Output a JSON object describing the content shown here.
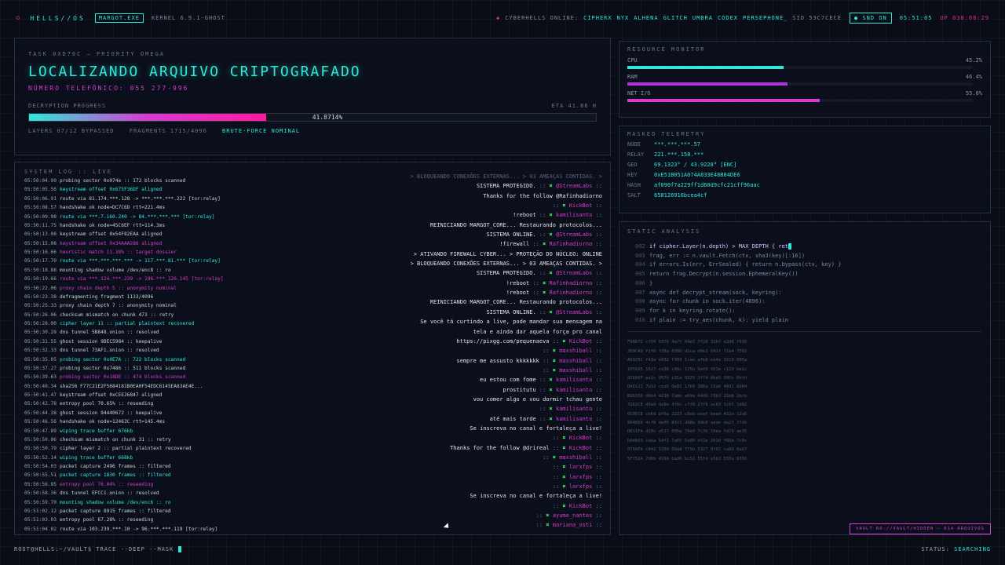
{
  "topbar": {
    "logo": "◇",
    "brand": "HELLS//OS",
    "user_tag": "MARGOT.EXE",
    "kernel": "KERNEL 6.9.1-GHOST",
    "online_label": "CYBERHELLS ONLINE:",
    "online_users": [
      "CIPHERX",
      "NYX",
      "ALHENA",
      "GLITCH",
      "UMBRA",
      "CODEX",
      "PERSEPHONE_"
    ],
    "sid": "SID 53C7CECE",
    "snd": "SND ON",
    "clock": "05:51:05",
    "uptime": "UP 038:08:29"
  },
  "task": {
    "id": "TASK 0XD70C — PRIORITY OMEGA",
    "title": "LOCALIZANDO ARQUIVO CRIPTOGRAFADO",
    "phone": "NÚMERO TELEFÔNICO: 055 277-996",
    "progress_label": "DECRYPTION PROGRESS",
    "eta": "ETA 41.86 H",
    "progress": 41.8714,
    "progress_text": "41.8714%",
    "layers": "LAYERS 07/12 BYPASSED",
    "fragments": "FRAGMENTS 1715/4096",
    "bruteforce": "BRUTE-FORCE NOMINAL"
  },
  "resource": {
    "title": "RESOURCE MONITOR",
    "items": [
      {
        "label": "CPU",
        "value": "45.2%",
        "pct": 45.2,
        "color": "#2ee8d8"
      },
      {
        "label": "RAM",
        "value": "46.4%",
        "pct": 46.4,
        "color": "#b530e0"
      },
      {
        "label": "NET I/O",
        "value": "55.6%",
        "pct": 55.6,
        "color": "#d73bd0"
      }
    ]
  },
  "telemetry": {
    "title": "MASKED TELEMETRY",
    "rows": [
      {
        "k": "NODE",
        "v": "***.***.***.57"
      },
      {
        "k": "RELAY",
        "v": "221.***.158.***"
      },
      {
        "k": "GEO",
        "v": "69.1323° / 43.9228° [ENC]"
      },
      {
        "k": "KEY",
        "v": "0xE51B051A074A833E48B84DE6"
      },
      {
        "k": "HASH",
        "v": "af090f7a229ff1d60d9cfc21cff96aac"
      },
      {
        "k": "SALT",
        "v": "658126916bcea4cf"
      }
    ]
  },
  "static": {
    "title": "STATIC ANALYSIS",
    "lines": [
      {
        "n": "002",
        "t": "if cipher.Layer(n.depth) > MAX_DEPTH { ret",
        "hi": true
      },
      {
        "n": "003",
        "t": "frag, err := n.vault.Fetch(ctx, sha3(key)[:16])"
      },
      {
        "n": "004",
        "t": "if errors.Is(err, ErrSealed) { return n.bypass(ctx, key) }"
      },
      {
        "n": "005",
        "t": "return frag.Decrypt(n.session.EphemeralKey())"
      },
      {
        "n": "006",
        "t": "}"
      },
      {
        "n": "007",
        "t": "async def decrypt_stream(sock, keyring):"
      },
      {
        "n": "008",
        "t": "async for chunk in sock.iter(4096):"
      },
      {
        "n": "009",
        "t": "for k in keyring.rotate():"
      },
      {
        "n": "010",
        "t": "if plain := try_aes(chunk, k): yield plain"
      }
    ],
    "hex": [
      "F9BD72 cf50 037b 4a7f 04e3 ff28 31bf a3d6 f035",
      "2E0CA9 f2f6 f28a 6380 d2ca d0e1 641f 71b4 7592",
      "A6025C f43a e932 f309 1cae afb8 ea4a 3219 605a",
      "105165 1627 ca38 c08c 125b 9af0 953e c123 be1c",
      "83606F ea1c 957b c31a 0325 1f7d 8be5 305c 0bfd",
      "DA0122 7b12 cea5 0e02 17b9 388a 15a6 4601 8d04",
      "B9535D d6b4 4238 7a8e a69a 44d9 73b3 21b8 2bcb",
      "72E2CE d0a9 da9e 4f6c c7f8 2ff6 ac63 5c65 1d82",
      "0C8ECE cb6d bf6a 2223 c8eb eeaf bead 422a 12a6",
      "804EE0 4cf8 de05 83f2 d98b 99b0 adde de27 77d5",
      "D011FA d20c a517 005e 79e0 7c3b 10ea fd79 ae35",
      "D04663 cbea 54f1 7a6f 5a00 df2e 2010 f66b 7c0c",
      "570AFA c842 5260 09a8 7f5b 5327 0f02 ca8d 8a67",
      "5F7524 7d0b 4166 ba36 bc52 55fd e5b3 555a 635b"
    ]
  },
  "vault": "VAULT RO://VAULT/HIDDEN — 814 ARQUIVOS",
  "syslog": {
    "title": "SYSTEM LOG :: LIVE",
    "entries": [
      {
        "t": "05:50:04.99",
        "m": "probing sector 0x074e :: 172 blocks scanned",
        "c": ""
      },
      {
        "t": "05:50:05.56",
        "m": "keystream offset 0x675F36DF aligned",
        "c": "c"
      },
      {
        "t": "05:50:06.91",
        "m": "route via 81.174.***.128 -> ***.***.***.222 [tor:relay]",
        "c": ""
      },
      {
        "t": "05:50:08.57",
        "m": "handshake ok node=DC7C6D rtt=221.4ms",
        "c": ""
      },
      {
        "t": "05:50:09.98",
        "m": "route via ***.7.160.240 -> 84.***.***.*** [tor:relay]",
        "c": "c"
      },
      {
        "t": "05:50:11.75",
        "m": "handshake ok node=45C6EF rtt=114.3ms",
        "c": ""
      },
      {
        "t": "05:50:13.08",
        "m": "keystream offset 0x54F82EAA aligned",
        "c": ""
      },
      {
        "t": "05:50:15.08",
        "m": "keystream offset 0x34AAA286 aligned",
        "c": "m"
      },
      {
        "t": "05:50:16.66",
        "m": "heuristic match 11.38% :: target dossier",
        "c": "m"
      },
      {
        "t": "05:50:17.70",
        "m": "route via ***.***.***.*** -> 117.***.81.*** [tor:relay]",
        "c": "c"
      },
      {
        "t": "05:50:18.88",
        "m": "mounting shadow volume /dev/enc8 :: ro",
        "c": ""
      },
      {
        "t": "05:50:19.66",
        "m": "route via ***.124.***.239 -> 196.***.126.145 [tor:relay]",
        "c": "m"
      },
      {
        "t": "05:50:22.06",
        "m": "proxy chain depth 5 :: anonymity nominal",
        "c": "m"
      },
      {
        "t": "05:50:23.38",
        "m": "defragmenting fragment 1133/4096",
        "c": ""
      },
      {
        "t": "05:50:25.33",
        "m": "proxy chain depth 7 :: anonymity nominal",
        "c": ""
      },
      {
        "t": "05:50:26.06",
        "m": "checksum mismatch on chunk 473 :: retry",
        "c": ""
      },
      {
        "t": "05:50:28.00",
        "m": "cipher layer 11 :: partial plaintext recovered",
        "c": "c"
      },
      {
        "t": "05:50:30.28",
        "m": "dns tunnel 5B848.onion :: resolved",
        "c": ""
      },
      {
        "t": "05:50:31.55",
        "m": "ghost session 9DEC5984 :: keepalive",
        "c": ""
      },
      {
        "t": "05:50:32.33",
        "m": "dns tunnel 73AF1.onion :: resolved",
        "c": ""
      },
      {
        "t": "05:50:35.05",
        "m": "probing sector 0x0E7A :: 722 blocks scanned",
        "c": "c"
      },
      {
        "t": "05:50:37.27",
        "m": "probing sector 0x7486 :: 511 blocks scanned",
        "c": ""
      },
      {
        "t": "05:50:39.63",
        "m": "probing sector 0x18DE :: 474 blocks scanned",
        "c": "m"
      },
      {
        "t": "05:50:40.34",
        "m": "sha256 F77C21E2F5684181B0EA0F54EDC614SEA83AE4E...",
        "c": ""
      },
      {
        "t": "05:50:41.47",
        "m": "keystream offset 0xCEE26847 aligned",
        "c": ""
      },
      {
        "t": "05:50:42.78",
        "m": "entropy pool 70.65% :: reseeding",
        "c": ""
      },
      {
        "t": "05:50:44.38",
        "m": "ghost session 94440672 :: keepalive",
        "c": ""
      },
      {
        "t": "05:50:46.56",
        "m": "handshake ok node=12463C rtt=145.4ms",
        "c": ""
      },
      {
        "t": "05:50:47.89",
        "m": "wiping trace buffer 676kb",
        "c": "c"
      },
      {
        "t": "05:50:50.06",
        "m": "checksum mismatch on chunk 31 :: retry",
        "c": ""
      },
      {
        "t": "05:50:50.79",
        "m": "cipher layer 2 :: partial plaintext recovered",
        "c": ""
      },
      {
        "t": "05:50:52.14",
        "m": "wiping trace buffer 668kb",
        "c": "c"
      },
      {
        "t": "05:50:54.03",
        "m": "packet capture 2496 frames :: filtered",
        "c": ""
      },
      {
        "t": "05:50:55.51",
        "m": "packet capture 1830 frames :: filtered",
        "c": "c"
      },
      {
        "t": "05:50:56.95",
        "m": "entropy pool 76.04% :: reseeding",
        "c": "m"
      },
      {
        "t": "05:50:58.36",
        "m": "dns tunnel EFCC1.onion :: resolved",
        "c": ""
      },
      {
        "t": "05:50:59.70",
        "m": "mounting shadow volume /dev/enc6 :: ro",
        "c": "c"
      },
      {
        "t": "05:51:02.12",
        "m": "packet capture 8915 frames :: filtered",
        "c": ""
      },
      {
        "t": "05:51:03.03",
        "m": "entropy pool 67.28% :: reseeding",
        "c": ""
      },
      {
        "t": "05:51:04.02",
        "m": "route via 103.239.***.10 -> 96.***.***.119 [tor:relay]",
        "c": ""
      }
    ]
  },
  "chat": [
    {
      "text": "> BLOQUEANDO CONEXÕES EXTERNAS... > 03 AMEAÇAS CONTIDAS. >",
      "cls": "ghost"
    },
    {
      "text": "SISTEMA PROTEGIDO.",
      "user": "@StreamLabs"
    },
    {
      "text": "Thanks for the follow @Rafinhadiorno",
      "user": ""
    },
    {
      "text": "",
      "user": "KickBot"
    },
    {
      "text": "!reboot",
      "user": "kamilisanto"
    },
    {
      "text": "REINICIANDO MARGOT_CORE... Restaurando protocolos...",
      "user": ""
    },
    {
      "text": "SISTEMA ONLINE.",
      "user": "@StreamLabs"
    },
    {
      "text": "!firewall",
      "user": "Rafinhadiorno"
    },
    {
      "text": "> ATIVANDO FIREWALL CYBER... > PROTEÇÃO DO NÚCLEO: ONLINE",
      "user": ""
    },
    {
      "text": "> BLOQUEANDO CONEXÕES EXTERNAS... > 03 AMEAÇAS CONTIDAS. >",
      "user": ""
    },
    {
      "text": "SISTEMA PROTEGIDO.",
      "user": "@StreamLabs"
    },
    {
      "text": "!reboot",
      "user": "Rafinhadiorno"
    },
    {
      "text": "!reboot",
      "user": "Rafinhadiorno"
    },
    {
      "text": "REINICIANDO MARGOT_CORE... Restaurando protocolos...",
      "user": ""
    },
    {
      "text": "SISTEMA ONLINE.",
      "user": "@StreamLabs"
    },
    {
      "text": "Se você tá curtindo a live, pode mandar sua mensagem na",
      "user": ""
    },
    {
      "text": "tela e ainda dar aquela força pro canal",
      "user": ""
    },
    {
      "text": "https://pixgg.com/pequenaeva",
      "user": "KickBot"
    },
    {
      "text": "",
      "user": "maxshiball"
    },
    {
      "text": "sempre me assusto kkkkkkk",
      "user": "maxshiball"
    },
    {
      "text": "",
      "user": "maxshiball"
    },
    {
      "text": "eu estou com fome",
      "user": "kamilisanto"
    },
    {
      "text": "prostitutu",
      "user": "kamilisanto"
    },
    {
      "text": "vou comer algo e vou dormir tchau gente",
      "user": ""
    },
    {
      "text": "",
      "user": "kamilisanto"
    },
    {
      "text": "até mais tarde",
      "user": "kamilisanto"
    },
    {
      "text": "Se inscreva no canal e fortaleça a live!",
      "user": ""
    },
    {
      "text": "",
      "user": "KickBot"
    },
    {
      "text": "Thanks for the follow @drireal",
      "user": "KickBot"
    },
    {
      "text": "",
      "user": "maxshiball"
    },
    {
      "text": "",
      "user": "larxfps"
    },
    {
      "text": "",
      "user": "larxfps"
    },
    {
      "text": "",
      "user": "larxfps"
    },
    {
      "text": "Se inscreva no canal e fortaleça a live!",
      "user": ""
    },
    {
      "text": "",
      "user": "KickBot"
    },
    {
      "text": "",
      "user": "ayume_nantes"
    },
    {
      "text": "",
      "user": "mariana_osti"
    }
  ],
  "cmd": "ROOT@HELLS:~/VAULT$ TRACE --DEEP --MASK",
  "status_label": "STATUS:",
  "status": "SEARCHING"
}
